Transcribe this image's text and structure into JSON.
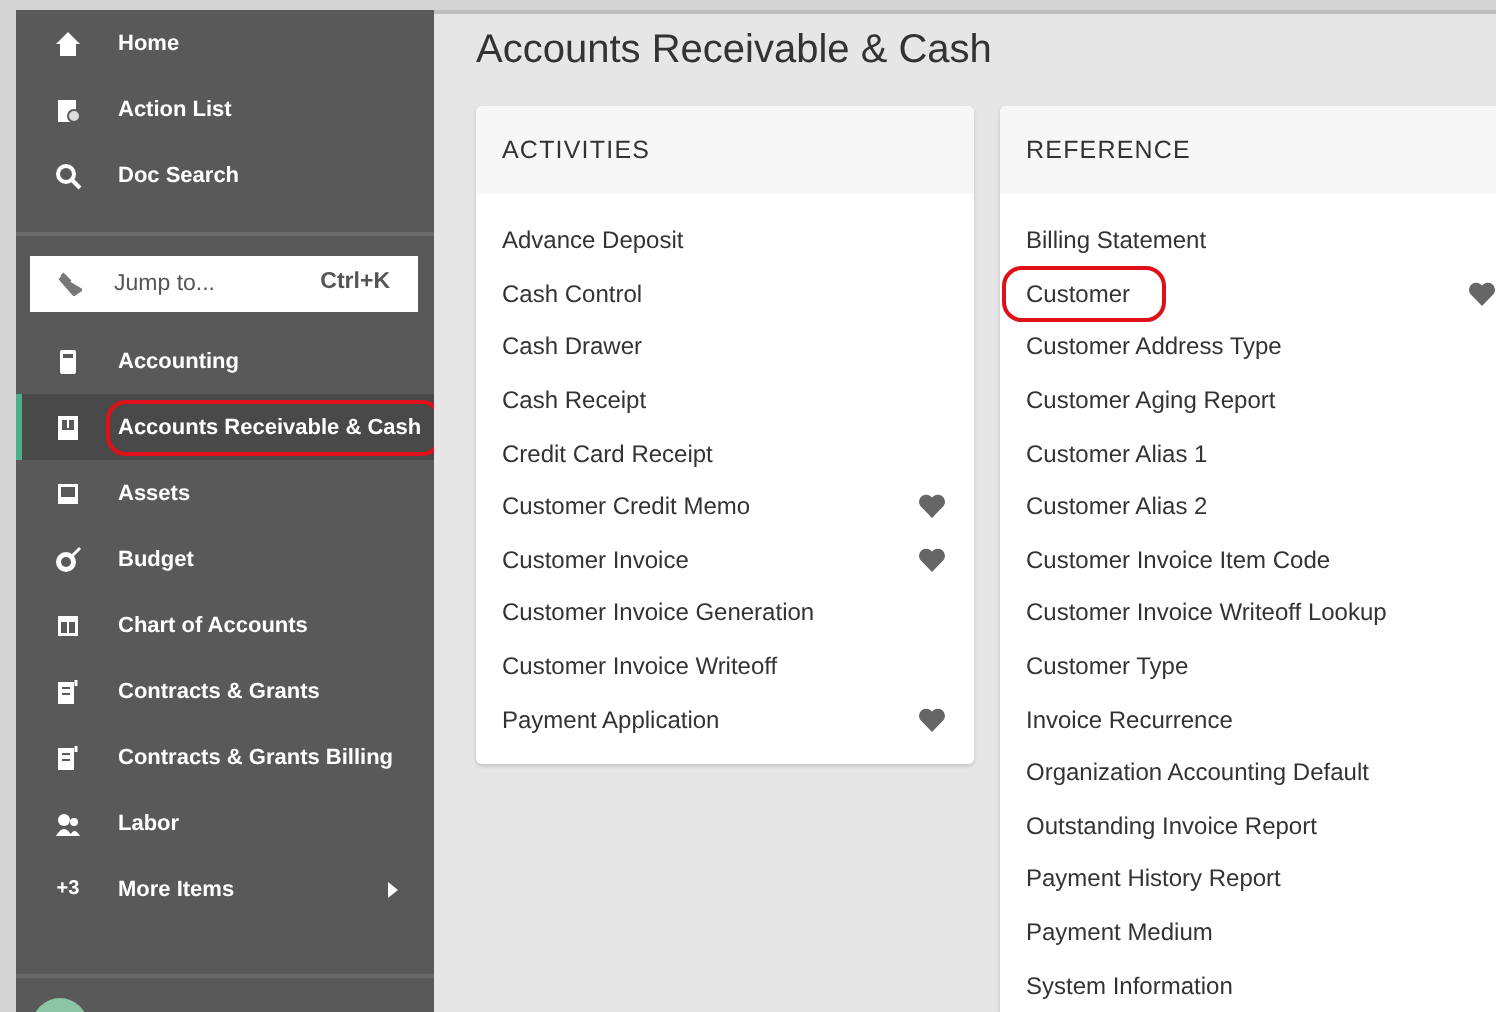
{
  "sidebar": {
    "items": [
      {
        "label": "Home",
        "selected": false,
        "highlighted": false
      },
      {
        "label": "Action List",
        "selected": false,
        "highlighted": false
      },
      {
        "label": "Doc Search",
        "selected": false,
        "highlighted": false
      }
    ],
    "jump": {
      "placeholder": "Jump to...",
      "shortcut": "Ctrl+K"
    },
    "modules": [
      {
        "label": "Accounting",
        "selected": false,
        "highlighted": false
      },
      {
        "label": "Accounts Receivable & Cash",
        "selected": true,
        "highlighted": true
      },
      {
        "label": "Assets",
        "selected": false,
        "highlighted": false
      },
      {
        "label": "Budget",
        "selected": false,
        "highlighted": false
      },
      {
        "label": "Chart of Accounts",
        "selected": false,
        "highlighted": false
      },
      {
        "label": "Contracts & Grants",
        "selected": false,
        "highlighted": false
      },
      {
        "label": "Contracts & Grants Billing",
        "selected": false,
        "highlighted": false
      },
      {
        "label": "Labor",
        "selected": false,
        "highlighted": false
      },
      {
        "label": "More Items",
        "badge": "+3",
        "submenu": true,
        "selected": false,
        "highlighted": false
      }
    ]
  },
  "page": {
    "title": "Accounts Receivable & Cash"
  },
  "cards": [
    {
      "title": "ACTIVITIES",
      "items": [
        {
          "label": "Advance Deposit",
          "favorite": false,
          "highlighted": false
        },
        {
          "label": "Cash Control",
          "favorite": false,
          "highlighted": false
        },
        {
          "label": "Cash Drawer",
          "favorite": false,
          "highlighted": false
        },
        {
          "label": "Cash Receipt",
          "favorite": false,
          "highlighted": false
        },
        {
          "label": "Credit Card Receipt",
          "favorite": false,
          "highlighted": false
        },
        {
          "label": "Customer Credit Memo",
          "favorite": true,
          "highlighted": false
        },
        {
          "label": "Customer Invoice",
          "favorite": true,
          "highlighted": false
        },
        {
          "label": "Customer Invoice Generation",
          "favorite": false,
          "highlighted": false
        },
        {
          "label": "Customer Invoice Writeoff",
          "favorite": false,
          "highlighted": false
        },
        {
          "label": "Payment Application",
          "favorite": true,
          "highlighted": false
        }
      ]
    },
    {
      "title": "REFERENCE",
      "items": [
        {
          "label": "Billing Statement",
          "favorite": false,
          "highlighted": false
        },
        {
          "label": "Customer",
          "favorite": true,
          "highlighted": true
        },
        {
          "label": "Customer Address Type",
          "favorite": false,
          "highlighted": false
        },
        {
          "label": "Customer Aging Report",
          "favorite": false,
          "highlighted": false
        },
        {
          "label": "Customer Alias 1",
          "favorite": false,
          "highlighted": false
        },
        {
          "label": "Customer Alias 2",
          "favorite": false,
          "highlighted": false
        },
        {
          "label": "Customer Invoice Item Code",
          "favorite": false,
          "highlighted": false
        },
        {
          "label": "Customer Invoice Writeoff Lookup",
          "favorite": false,
          "highlighted": false
        },
        {
          "label": "Customer Type",
          "favorite": false,
          "highlighted": false
        },
        {
          "label": "Invoice Recurrence",
          "favorite": false,
          "highlighted": false
        },
        {
          "label": "Organization Accounting Default",
          "favorite": false,
          "highlighted": false
        },
        {
          "label": "Outstanding Invoice Report",
          "favorite": false,
          "highlighted": false
        },
        {
          "label": "Payment History Report",
          "favorite": false,
          "highlighted": false
        },
        {
          "label": "Payment Medium",
          "favorite": false,
          "highlighted": false
        },
        {
          "label": "System Information",
          "favorite": false,
          "highlighted": false
        }
      ]
    }
  ]
}
